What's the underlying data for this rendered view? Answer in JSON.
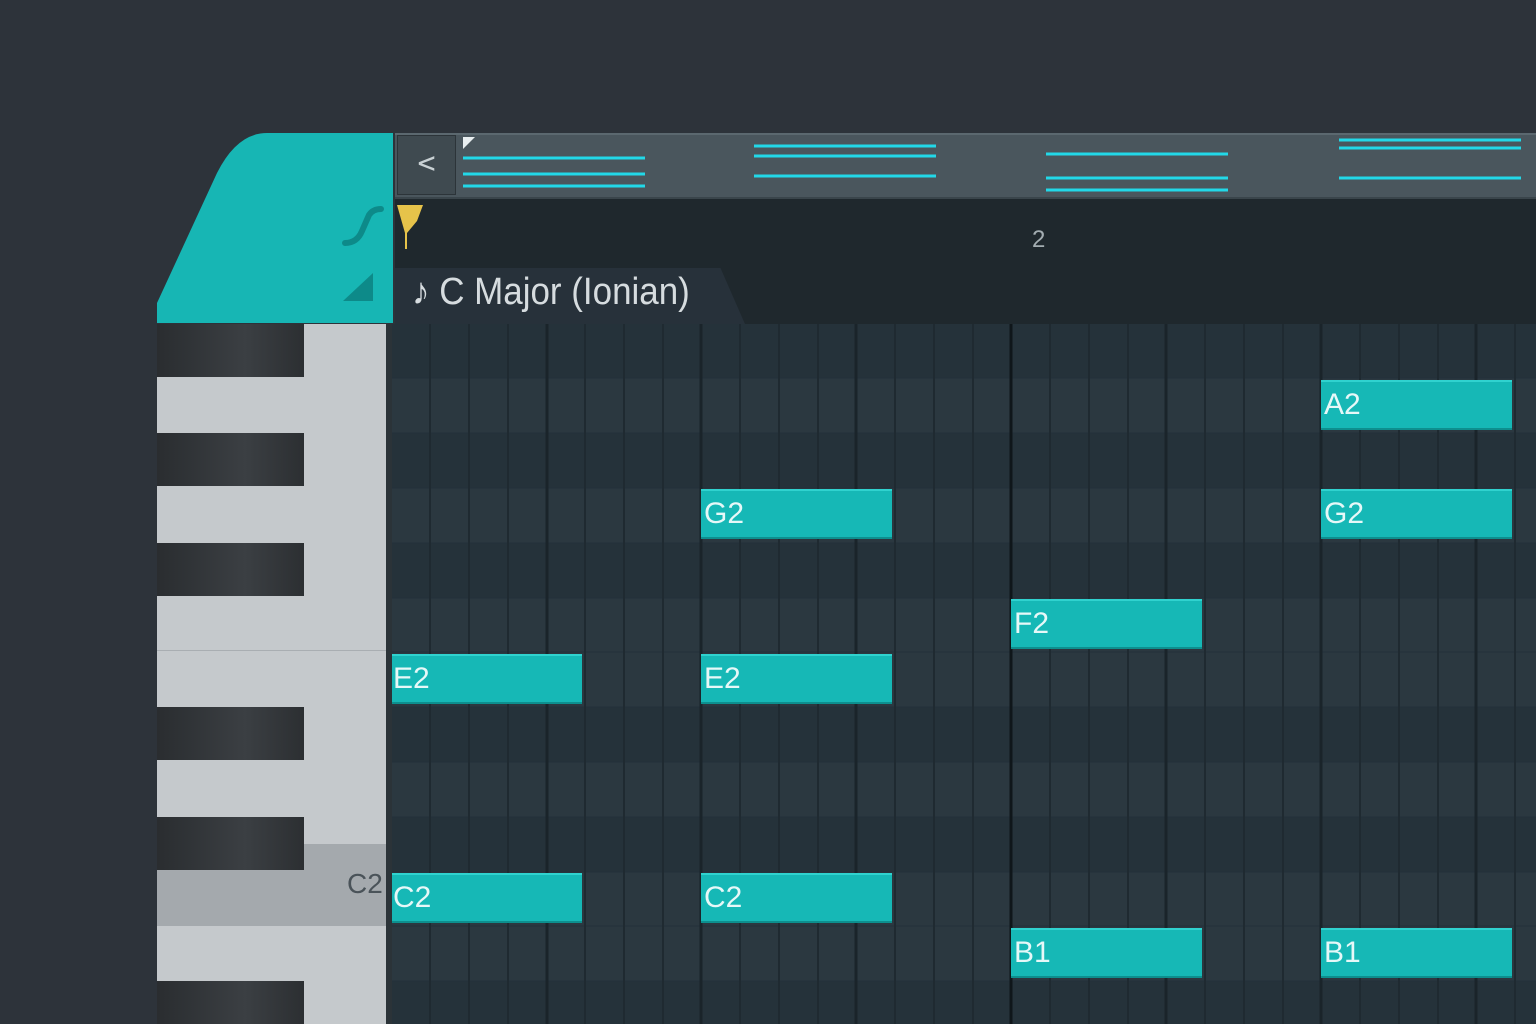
{
  "colors": {
    "accent": "#16b8b6",
    "background": "#2d333a",
    "ruler": "#1f282d",
    "grid": "#2b3840",
    "playhead": "#e6c34a"
  },
  "navigation": {
    "back_icon": "chevron-left-icon",
    "back_label": "<"
  },
  "ruler": {
    "bar_label": "2"
  },
  "scale": {
    "icon": "eighth-note-icon",
    "label": "♪ C Major (Ionian)"
  },
  "tools": {
    "slide_icon": "slide-curve-icon",
    "velocity_icon": "ramp-icon"
  },
  "piano": {
    "highlight_key_label": "C2"
  },
  "notes": [
    {
      "label": "A2"
    },
    {
      "label": "G2"
    },
    {
      "label": "G2"
    },
    {
      "label": "F2"
    },
    {
      "label": "E2"
    },
    {
      "label": "E2"
    },
    {
      "label": "C2"
    },
    {
      "label": "C2"
    },
    {
      "label": "B1"
    },
    {
      "label": "B1"
    }
  ]
}
